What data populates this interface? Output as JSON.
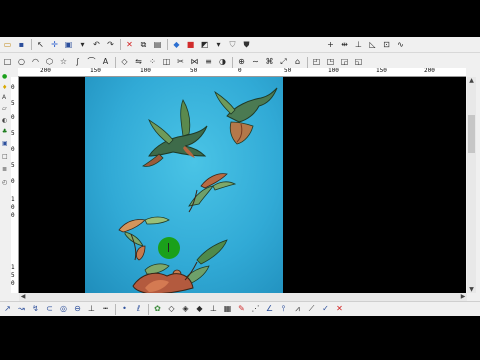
{
  "colors": {
    "canvas": "#31aad6",
    "cursor": "#1aa01a",
    "letterbox": "#000000",
    "chrome": "#f0f0f0"
  },
  "toolbar_top": {
    "icons": [
      "open-file-icon",
      "save-icon",
      "cursor-icon",
      "grid-icon",
      "select-icon",
      "frame-icon",
      "dropdown-arrow-icon",
      "undo-icon",
      "redo-icon",
      "delete-icon",
      "copy-icon",
      "paste-icon",
      "layers-icon",
      "color-icon",
      "view-3d-icon",
      "dropdown-arrow-icon",
      "shield-icon",
      "shield-dark-icon",
      "plus-icon",
      "move-icon",
      "measure-icon",
      "scale-icon",
      "node-icon",
      "wave-icon",
      "shield-icon",
      "shield-dark-icon"
    ]
  },
  "toolbar_second": {
    "icons": [
      "square-icon",
      "circle-icon",
      "arc-icon",
      "polygon-icon",
      "star-icon",
      "spline-icon",
      "bezier-icon",
      "text-icon",
      "node-edit-icon",
      "mirror-icon",
      "array-icon",
      "offset-icon",
      "trim-icon",
      "join-icon",
      "align-icon",
      "boolean-icon",
      "dropdown-arrow-icon",
      "weld-icon",
      "smooth-icon",
      "distort-icon",
      "transform-icon",
      "close-vector-icon",
      "vector-tool-1-icon",
      "vector-tool-2-icon",
      "vector-tool-3-icon",
      "vector-tool-4-icon"
    ]
  },
  "ruler_h": {
    "ticks": [
      "200",
      "150",
      "100",
      "50",
      "0",
      "50",
      "100",
      "150",
      "200"
    ]
  },
  "ruler_v": {
    "ticks": [
      "0",
      "5",
      "0",
      "5",
      "0",
      "5",
      "0",
      "1",
      "0",
      "0",
      "1",
      "5",
      "0"
    ]
  },
  "bottom_toolbar": {
    "icons": [
      "line-tool-icon",
      "curve-tool-icon",
      "zigzag-tool-icon",
      "pull-icon",
      "sculpt-icon",
      "reduce-icon",
      "chisel-icon",
      "point-icon",
      "snap-icon",
      "node-add-icon",
      "contour-icon",
      "bevel-icon",
      "relief-icon",
      "emboss-icon",
      "mirror-relief-icon",
      "pattern-icon",
      "paint-icon",
      "tool-path-icon",
      "bit-icon",
      "drill-icon",
      "sim-icon",
      "export-icon",
      "check-icon",
      "cancel-icon"
    ]
  },
  "left_tools": {
    "icons": [
      "green-dot-icon",
      "bulb-icon",
      "letter-icon",
      "plane-icon",
      "sphere-icon",
      "tree-icon",
      "box-icon",
      "square-icon",
      "layers-icon",
      "clock-icon"
    ]
  }
}
